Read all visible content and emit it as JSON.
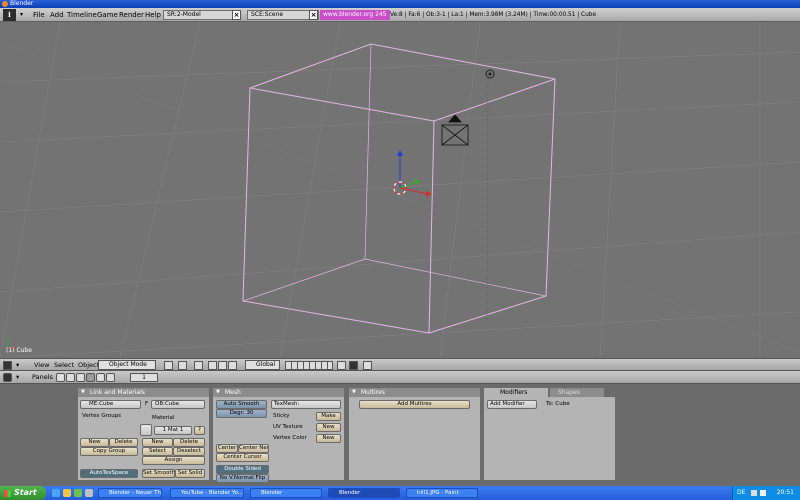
{
  "window": {
    "title": "Blender"
  },
  "topbar": {
    "menus": [
      "File",
      "Add",
      "Timeline",
      "Game",
      "Render",
      "Help"
    ],
    "screen_field": "SR:2-Model",
    "scene_field": "SCE:Scene",
    "www_button": "www.blender.org 245",
    "stats": "Ve:8 | Fa:6 | Ob:3-1 | La:1  | Mem:3.98M (3.24M)  | Time:00:00.51 | Cube"
  },
  "viewport": {
    "status": "(1) Cube"
  },
  "view_header": {
    "menus": [
      "View",
      "Select",
      "Object"
    ],
    "mode": "Object Mode",
    "orientation": "Global"
  },
  "buttons_header": {
    "label": "Panels",
    "frame": "1"
  },
  "panels": {
    "link_materials": {
      "title": "Link and Materials",
      "me_field": "ME:Cube",
      "f_label": "F",
      "ob_field": "OB:Cube",
      "vertex_groups": "Vertex Groups",
      "material": "Material",
      "mat_counter": "1 Mat 1",
      "mat_q": "?",
      "vg_new": "New",
      "vg_delete": "Delete",
      "copy_group": "Copy Group",
      "mat_new": "New",
      "mat_delete": "Delete",
      "select": "Select",
      "deselect": "Deselect",
      "assign": "Assign",
      "autotexspace": "AutoTexSpace",
      "set_smooth": "Set Smooth",
      "set_solid": "Set Solid"
    },
    "mesh": {
      "title": "Mesh",
      "auto_smooth": "Auto Smooth",
      "degr": "Degr: 30",
      "texmesh": "TexMesh:",
      "sticky": "Sticky",
      "uv_texture": "UV Texture",
      "vertex_color": "Vertex Color",
      "make": "Make",
      "new1": "New",
      "new2": "New",
      "center": "Center",
      "center_new": "Center New",
      "center_cursor": "Center Cursor",
      "double_sided": "Double Sided",
      "no_v_normal_flip": "No V.Normal Flip"
    },
    "multires": {
      "title": "Multires",
      "add_multires": "Add Multires"
    },
    "modifiers": {
      "tab_modifiers": "Modifiers",
      "tab_shapes": "Shapes",
      "add_modifier": "Add Modifier",
      "to": "To: Cube"
    }
  },
  "taskbar": {
    "start": "Start",
    "tasks": [
      "Blender - Neuer The...",
      "YouTube - Blender Yo...",
      "Blender",
      "Blender",
      "hill1.JPG - Paint"
    ],
    "lang": "DE",
    "clock": "20:51"
  },
  "colors": {
    "wire": "#e4b6e4",
    "viewport": "#737373",
    "grid": "#7d7d7d"
  }
}
